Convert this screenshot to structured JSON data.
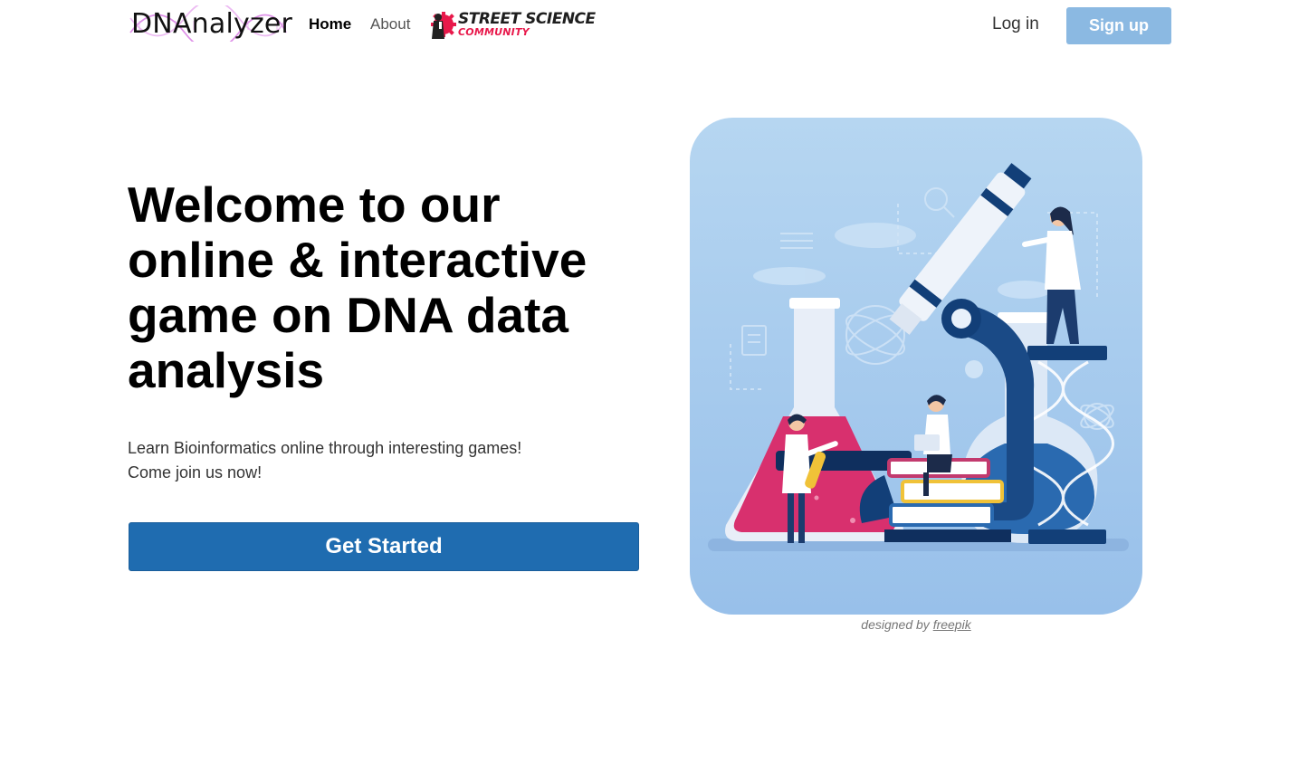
{
  "navbar": {
    "brand": "DNAnalyzer",
    "links": [
      {
        "label": "Home"
      },
      {
        "label": "About"
      }
    ],
    "partner_logo": {
      "line1": "STREET SCIENCE",
      "line2": "COMMUNITY"
    },
    "login_label": "Log in",
    "signup_label": "Sign up"
  },
  "hero": {
    "title": "Welcome to our online & interactive game on DNA data analysis",
    "subtitle_lines": [
      "Learn Bioinformatics online through interesting games!",
      "Come join us now!"
    ],
    "cta_label": "Get Started"
  },
  "illustration": {
    "credit_prefix": "designed by",
    "credit_link": "freepik"
  },
  "colors": {
    "accent": "#1f6cb0",
    "signup_bg": "#8bb9e2",
    "brand_dna": "#d36be0",
    "illus_bg": "#a9cdee",
    "navy": "#1c3c6e",
    "magenta": "#d8306e",
    "partner_red": "#e8194b"
  }
}
